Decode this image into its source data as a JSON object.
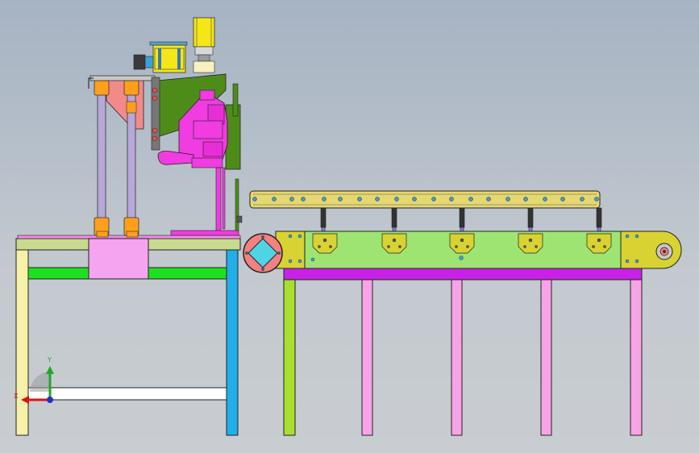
{
  "viewport": {
    "background_top": "#a6b3c3",
    "background_bottom": "#c9cdd1"
  },
  "triad": {
    "x_label": "X",
    "y_label": "Y",
    "x_color": "#e01010",
    "y_color": "#1fa82a",
    "z_color": "#2030d0"
  },
  "colors": {
    "left_table_top": "#c7da8e",
    "left_table_legs_left": "#f6f0a8",
    "left_table_legs_right": "#22aee8",
    "left_table_rail": "#1fe01f",
    "column": "#b8a8d8",
    "column_collar": "#ff9f1a",
    "gusset": "#f28a8a",
    "motor": "#f5e619",
    "bracket_plate": "#4e8c1a",
    "magenta_body": "#f03ce0",
    "conveyor_frame": "#9ee472",
    "conveyor_endcap": "#d8d233",
    "conveyor_rail": "#e6d870",
    "conveyor_base": "#c822e6",
    "conveyor_leg_outer": "#a8df30",
    "conveyor_leg_inner": "#f7a4e6",
    "drive_square": "#4fd4e6",
    "drive_ring": "#f48080",
    "bottom_bar": "#ffffff"
  }
}
